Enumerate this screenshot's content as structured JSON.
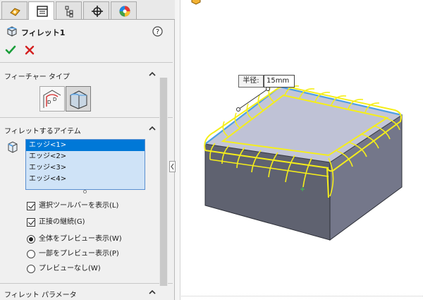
{
  "feature": {
    "title": "フィレット1"
  },
  "sections": {
    "feature_type": {
      "label": "フィーチャー タイプ"
    },
    "items_to_fillet": {
      "label": "フィレットするアイテム",
      "edges": [
        "エッジ<1>",
        "エッジ<2>",
        "エッジ<3>",
        "エッジ<4>"
      ],
      "selected_index": 0
    },
    "fillet_params": {
      "label": "フィレット パラメータ"
    }
  },
  "options": {
    "show_toolbar": {
      "label": "選択ツールバーを表示(L)",
      "checked": true
    },
    "tangent_propagation": {
      "label": "正接の継続(G)",
      "checked": true
    },
    "preview_full": {
      "label": "全体をプレビュー表示(W)",
      "selected": true
    },
    "preview_partial": {
      "label": "一部をプレビュー表示(P)",
      "selected": false
    },
    "preview_none": {
      "label": "プレビューなし(W)",
      "selected": false
    }
  },
  "dimension": {
    "label": "半径:",
    "value": "15mm"
  },
  "colors": {
    "accent_blue": "#0078d7",
    "fillet_preview": "#f5ee1a",
    "edge_highlight": "#4d9fe6",
    "ok_green": "#1a9e3a",
    "cancel_red": "#d42020"
  }
}
